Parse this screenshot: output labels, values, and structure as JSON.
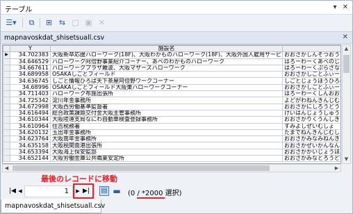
{
  "window": {
    "title": "テーブル",
    "pin": "▾",
    "close": "✕"
  },
  "toolbar": {
    "options_icon": "☰▾",
    "buttons": [
      {
        "name": "related-tables",
        "glyph": "⧉"
      },
      {
        "name": "select-by-attributes",
        "glyph": "⊞"
      },
      {
        "name": "switch-selection",
        "glyph": "⇆"
      },
      {
        "name": "clear-selection",
        "glyph": "▢"
      },
      {
        "name": "zoom-selected",
        "glyph": "▣"
      },
      {
        "name": "delete-selected",
        "glyph": "✕"
      }
    ]
  },
  "tab": {
    "label": "mapnavoskdat_shisetsuall.csv",
    "close": "✕"
  },
  "table": {
    "columns": [
      "Y",
      "施設名",
      ""
    ],
    "rows": [
      [
        "34.702383",
        "大阪新卒応援ハローワーク(18F)、大阪わかものハローワーク(18F)、大阪外国人雇用サービ",
        "おおさかしんそつおうえ"
      ],
      [
        "34.646529",
        "ハローワーク阿倍野事業紹介コーナー、あべのわかものハローワーク",
        "はろーわーくあべのじぎ"
      ],
      [
        "34.667611",
        "ハローワークプラザ難波、大阪マザーズハローワーク",
        "はろーわーくぷらざなんぱ"
      ],
      [
        "34.689958",
        "OSAKAしごとフィールド",
        "おおさかしごとふぃーるど"
      ],
      [
        "34.636745",
        "しごと情報ひろば天下茶屋阿倍野ワークコーナー",
        "しごとじょうほうひろばて"
      ],
      [
        "34.68996",
        "OSAKAしごとフィールド大阪東ハローワークコーナー",
        "おおさかしごとふぃーる"
      ],
      [
        "34.711403",
        "ハローワーク布施出張所",
        "はろーわーくしんおおさ"
      ],
      [
        "34.725342",
        "淀川年金事務所",
        "よどがわねんきんじむしょ"
      ],
      [
        "34.672998",
        "大阪西労働基準監督署",
        "おおさかにしろうどうきじ"
      ],
      [
        "34.616494",
        "総合政策課題交付金大阪主管事務所",
        "けいはんじょうしゅうとえ"
      ],
      [
        "34.610344",
        "大阪陸運支局なにわ自動車検査登録事務所",
        "おおさかりくうんしきょく"
      ],
      [
        "34.610964",
        "住吉税務署",
        "すみよしぜいむしょ"
      ],
      [
        "34.620132",
        "玉出年金事務所",
        "たまでねんきんじむしょ"
      ],
      [
        "34.623764",
        "大阪南年金事務所",
        "おおさかみなみねんきん"
      ],
      [
        "34.635158",
        "大阪税関南港出張所",
        "おおさかぜいかんなんこ"
      ],
      [
        "34.653394",
        "大阪海上保安監部",
        "おおさかかいじょうほあ"
      ],
      [
        "34.652144",
        "大阪労働金庫公共職業安定所",
        "おおさかみなとろうどうき"
      ]
    ]
  },
  "annotation": "最後のレコードに移動",
  "navigator": {
    "first": "|◀",
    "prev": "◀",
    "current_record": "1",
    "next": "▶",
    "last": "▶|",
    "show_all_icon": "▤",
    "show_selected_icon": "▬",
    "count_text": "(0 / *2000 選択)"
  },
  "bottom_tab": {
    "label": "mapnavoskdat_shisetsuall.csv"
  },
  "colors": {
    "accent": "#2f5f9e",
    "annotation_red": "#e8202a"
  }
}
